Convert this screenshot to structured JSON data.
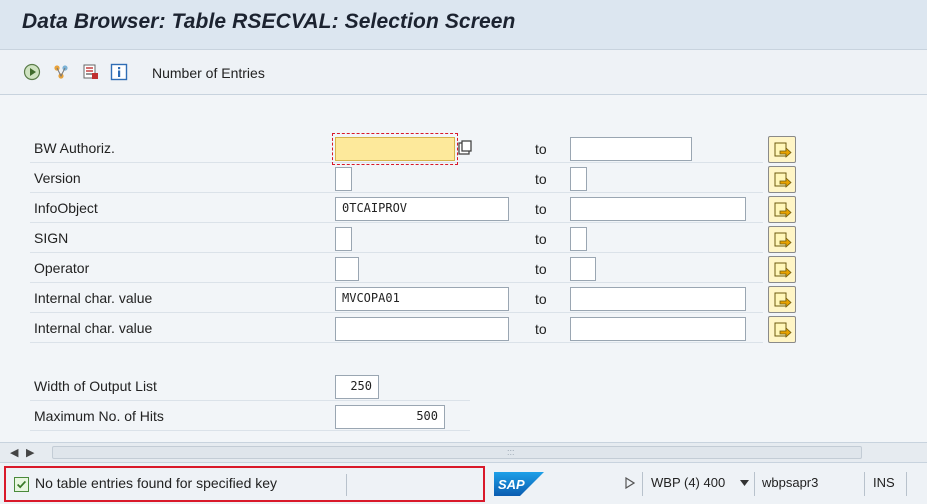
{
  "window": {
    "title": "Data Browser: Table RSECVAL: Selection Screen"
  },
  "toolbar": {
    "number_of_entries_label": "Number of Entries"
  },
  "form": {
    "to_label": "to",
    "rows": [
      {
        "label": "BW Authoriz.",
        "low_value": "",
        "high_value": ""
      },
      {
        "label": "Version",
        "low_value": "",
        "high_value": ""
      },
      {
        "label": "InfoObject",
        "low_value": "0TCAIPROV",
        "high_value": ""
      },
      {
        "label": "SIGN",
        "low_value": "",
        "high_value": ""
      },
      {
        "label": "Operator",
        "low_value": "",
        "high_value": ""
      },
      {
        "label": "Internal char. value",
        "low_value": "MVCOPA01",
        "high_value": ""
      },
      {
        "label": "Internal char. value",
        "low_value": "",
        "high_value": ""
      }
    ],
    "output": {
      "width_label": "Width of Output List",
      "width_value": "250",
      "max_hits_label": "Maximum No. of Hits",
      "max_hits_value": "500"
    }
  },
  "scroll": {
    "grip": ":::"
  },
  "status_bar": {
    "message": "No table entries found for specified key",
    "system": "WBP (4) 400",
    "server": "wbpsapr3",
    "mode": "INS"
  },
  "colors": {
    "required_field": "#fde99b",
    "highlight_border": "#d9192a",
    "sap_blue": "#0a6ed1"
  },
  "icons": [
    "execute-icon",
    "hierarchy-icon",
    "selection-options-icon",
    "info-icon",
    "multiple-selection-icon",
    "success-check-icon",
    "sap-logo",
    "play-icon",
    "dropdown-triangle-icon"
  ]
}
